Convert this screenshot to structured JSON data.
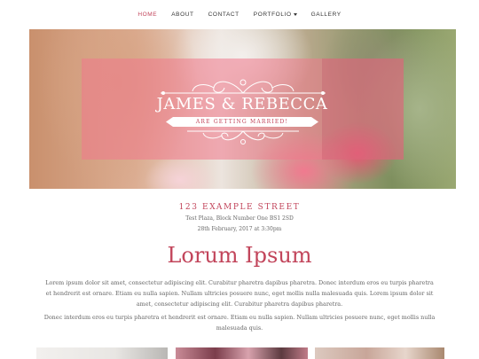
{
  "nav": {
    "items": [
      {
        "label": "HOME",
        "active": true
      },
      {
        "label": "ABOUT",
        "active": false
      },
      {
        "label": "CONTACT",
        "active": false
      },
      {
        "label": "PORTFOLIO",
        "active": false,
        "dropdown": true
      },
      {
        "label": "GALLERY",
        "active": false
      }
    ]
  },
  "hero": {
    "title": "JAMES & REBECCA",
    "subtitle": "ARE GETTING MARRIED!"
  },
  "event": {
    "street": "123 EXAMPLE STREET",
    "address": "Test Plaza, Block Number One BS1 2SD",
    "datetime": "28th February, 2017 at 3:30pm"
  },
  "main": {
    "heading": "Lorum Ipsum",
    "paragraph1": "Lorem ipsum dolor sit amet, consectetur adipiscing elit. Curabitur pharetra dapibus pharetra. Donec interdum eros eu turpis pharetra et hendrerit est ornare. Etiam eu nulla sapien. Nullam ultricies posuere nunc, eget mollis nulla malesuada quis. Lorem ipsum dolor sit amet, consectetur adipiscing elit. Curabitur pharetra dapibus pharetra.",
    "paragraph2": "Donec interdum eros eu turpis pharetra et hendrerit est ornare. Etiam eu nulla sapien. Nullam ultricies posuere nunc, eget mollis nulla malesuada quis."
  },
  "colors": {
    "accent": "#c2455b",
    "overlay": "#f0788c"
  }
}
